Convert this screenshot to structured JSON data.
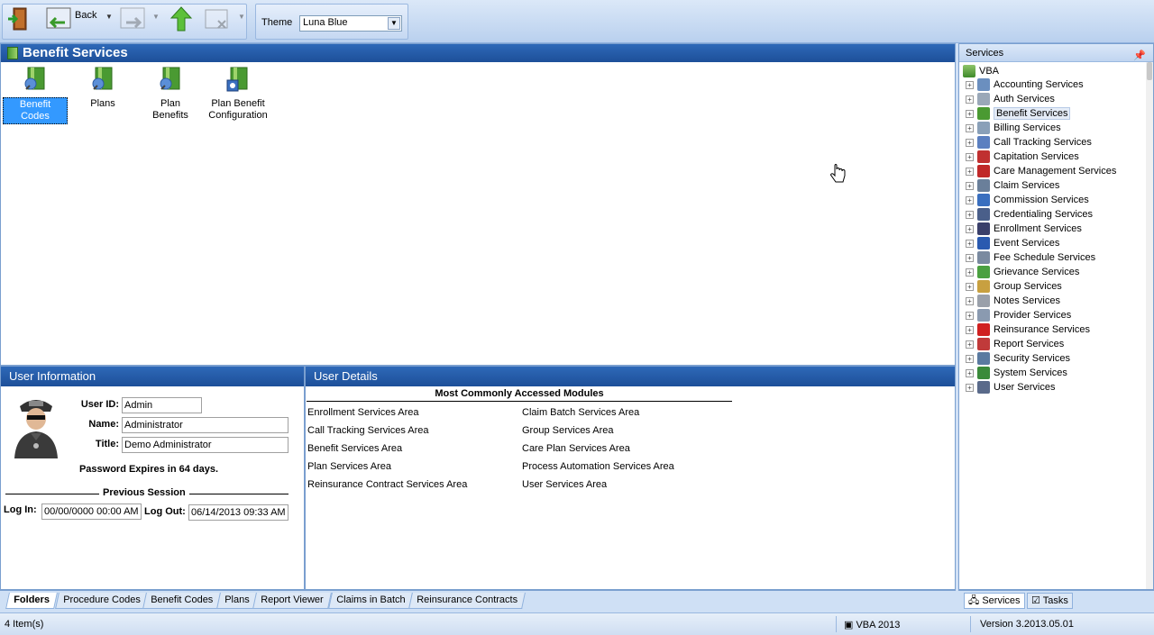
{
  "toolbar": {
    "back_label": "Back",
    "theme_label": "Theme",
    "theme_value": "Luna Blue",
    "icons": [
      "exit-door-icon",
      "back-arrow-icon",
      "forward-arrow-icon",
      "up-arrow-icon",
      "close-window-icon"
    ]
  },
  "main": {
    "title": "Benefit Services",
    "modules": [
      {
        "label": "Benefit Codes",
        "icon": "benefit-codes-icon"
      },
      {
        "label": "Plans",
        "icon": "plans-icon"
      },
      {
        "label": "Plan Benefits",
        "icon": "plan-benefits-icon"
      },
      {
        "label": "Plan Benefit Configuration",
        "icon": "plan-benefit-config-icon"
      }
    ]
  },
  "user_info": {
    "title": "User Information",
    "user_id_label": "User ID:",
    "user_id": "Admin",
    "name_label": "Name:",
    "name": "Administrator",
    "title_label": "Title:",
    "title_value": "Demo Administrator",
    "password_notice": "Password Expires in 64 days.",
    "previous_session": "Previous Session",
    "login_label": "Log In:",
    "login_value": "00/00/0000 00:00 AM",
    "logout_label": "Log Out:",
    "logout_value": "06/14/2013 09:33 AM"
  },
  "user_details": {
    "title": "User Details",
    "modules_heading": "Most Commonly Accessed Modules",
    "col1": [
      "Enrollment Services Area",
      "Call Tracking Services Area",
      "Benefit Services Area",
      "Plan Services Area",
      "Reinsurance Contract Services Area"
    ],
    "col2": [
      "Claim Batch Services Area",
      "Group Services Area",
      "Care Plan Services Area",
      "Process Automation Services Area",
      "User Services Area"
    ]
  },
  "bottom_tabs": [
    "Folders",
    "Procedure Codes",
    "Benefit Codes",
    "Plans",
    "Report Viewer",
    "Claims in Batch",
    "Reinsurance Contracts"
  ],
  "services_panel": {
    "title": "Services",
    "root": "VBA",
    "items": [
      "Accounting Services",
      "Auth Services",
      "Benefit Services",
      "Billing Services",
      "Call Tracking Services",
      "Capitation Services",
      "Care Management Services",
      "Claim Services",
      "Commission Services",
      "Credentialing Services",
      "Enrollment Services",
      "Event Services",
      "Fee Schedule Services",
      "Grievance Services",
      "Group Services",
      "Notes Services",
      "Provider Services",
      "Reinsurance Services",
      "Report Services",
      "Security Services",
      "System Services",
      "User Services"
    ],
    "tabs": [
      "Services",
      "Tasks"
    ]
  },
  "status": {
    "items_count": "4 Item(s)",
    "app": "VBA 2013",
    "version": "Version 3.2013.05.01"
  }
}
